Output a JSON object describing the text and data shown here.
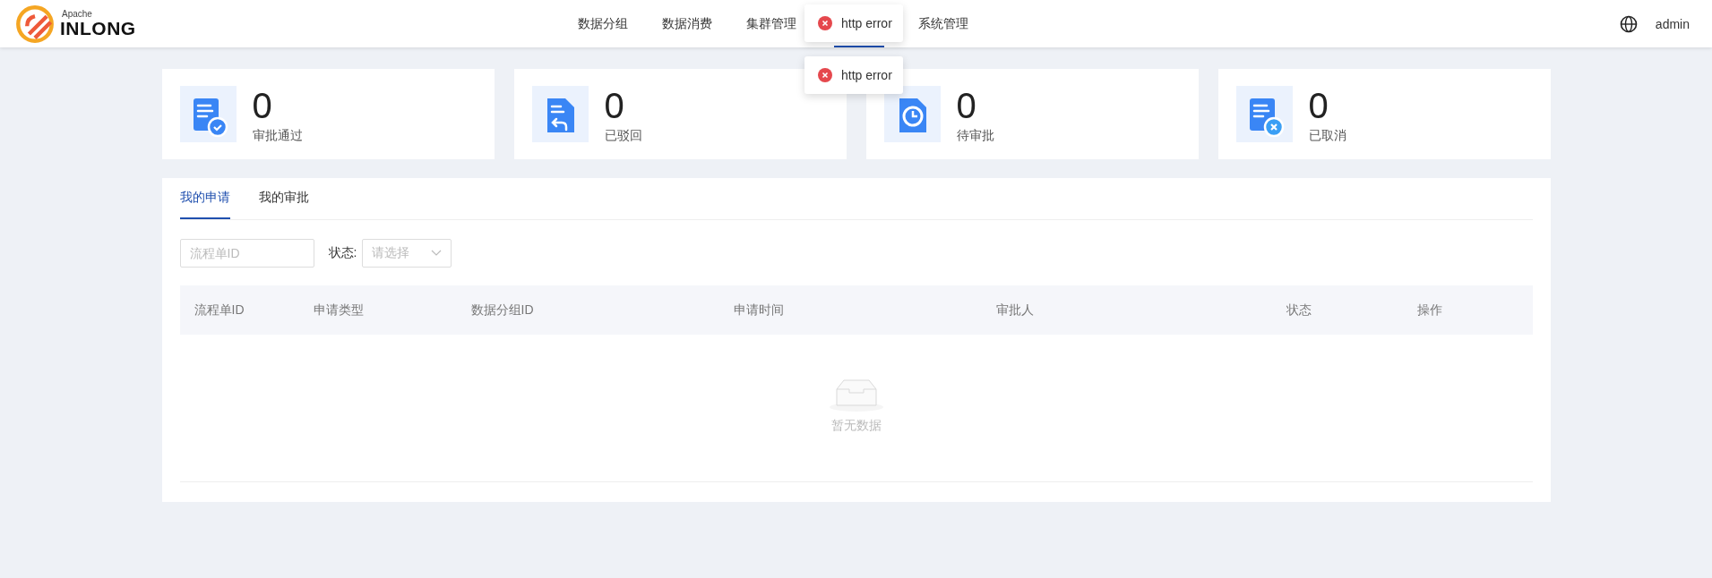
{
  "header": {
    "logo": {
      "small": "Apache",
      "big": "INLONG"
    },
    "nav": [
      {
        "label": "数据分组",
        "selected": false
      },
      {
        "label": "数据消费",
        "selected": false
      },
      {
        "label": "集群管理",
        "selected": false
      },
      {
        "selected": true
      },
      {
        "label": "系统管理",
        "selected": false
      }
    ],
    "user": "admin"
  },
  "toasts": [
    {
      "kind": "error",
      "text": "http error"
    },
    {
      "kind": "error",
      "text": "http error"
    }
  ],
  "stats": [
    {
      "kind": "approved",
      "value": "0",
      "label": "审批通过"
    },
    {
      "kind": "rejected",
      "value": "0",
      "label": "已驳回"
    },
    {
      "kind": "pending",
      "value": "0",
      "label": "待审批"
    },
    {
      "kind": "cancelled",
      "value": "0",
      "label": "已取消"
    }
  ],
  "tabs": [
    {
      "label": "我的申请",
      "selected": true
    },
    {
      "label": "我的审批",
      "selected": false
    }
  ],
  "filters": {
    "search": {
      "placeholder": "流程单ID"
    },
    "status": {
      "label": "状态:",
      "placeholder": "请选择"
    }
  },
  "table": {
    "columns": [
      "流程单ID",
      "申请类型",
      "数据分组ID",
      "申请时间",
      "审批人",
      "状态",
      "操作"
    ],
    "empty_text": "暂无数据"
  }
}
